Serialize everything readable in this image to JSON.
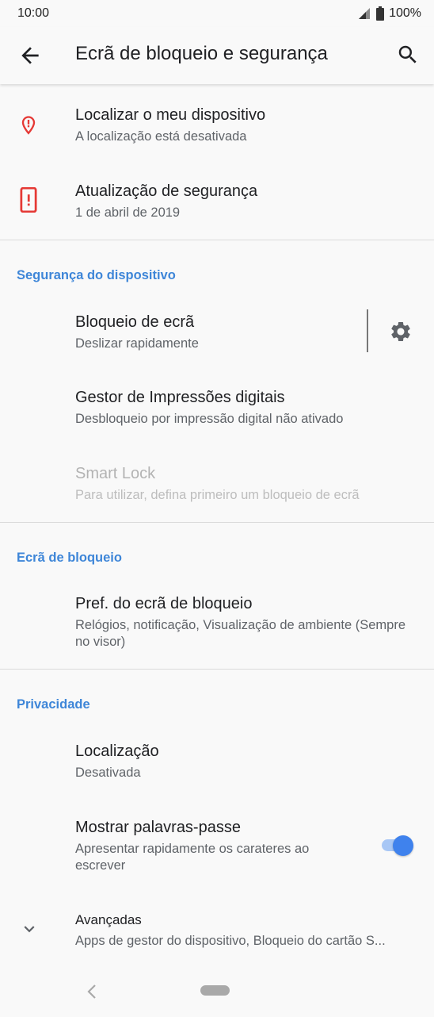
{
  "status_bar": {
    "time": "10:00",
    "battery": "100%"
  },
  "app_bar": {
    "title": "Ecrã de bloqueio e segurança",
    "back_icon": "arrow-back-icon",
    "search_icon": "search-icon"
  },
  "top_items": [
    {
      "title": "Localizar o meu dispositivo",
      "subtitle": "A localização está desativada",
      "icon": "location-alert-icon",
      "icon_color": "#e53935"
    },
    {
      "title": "Atualização de segurança",
      "subtitle": "1 de abril de 2019",
      "icon": "phone-alert-icon",
      "icon_color": "#e53935"
    }
  ],
  "sections": {
    "device_security": {
      "header": "Segurança do dispositivo",
      "items": [
        {
          "title": "Bloqueio de ecrã",
          "subtitle": "Deslizar rapidamente",
          "icon": "gear-icon"
        },
        {
          "title": "Gestor de Impressões digitais",
          "subtitle": "Desbloqueio por impressão digital não ativado"
        },
        {
          "title": "Smart Lock",
          "subtitle": "Para utilizar, defina primeiro um bloqueio de ecrã",
          "enabled": false
        }
      ]
    },
    "lock_screen": {
      "header": "Ecrã de bloqueio",
      "items": [
        {
          "title": "Pref. do ecrã de bloqueio",
          "subtitle": "Relógios, notificação, Visualização de ambiente (Sempre no visor)"
        }
      ]
    },
    "privacy": {
      "header": "Privacidade",
      "items": [
        {
          "title": "Localização",
          "subtitle": "Desativada"
        },
        {
          "title": "Mostrar palavras-passe",
          "subtitle": "Apresentar rapidamente os carateres ao escrever",
          "toggle": true
        },
        {
          "title": "Avançadas",
          "subtitle": "Apps de gestor do dispositivo, Bloqueio do cartão S...",
          "icon": "chevron-down-icon"
        }
      ]
    }
  },
  "colors": {
    "accent": "#3e86d8",
    "toggle_on": "#3f82ed",
    "alert": "#e53935"
  }
}
